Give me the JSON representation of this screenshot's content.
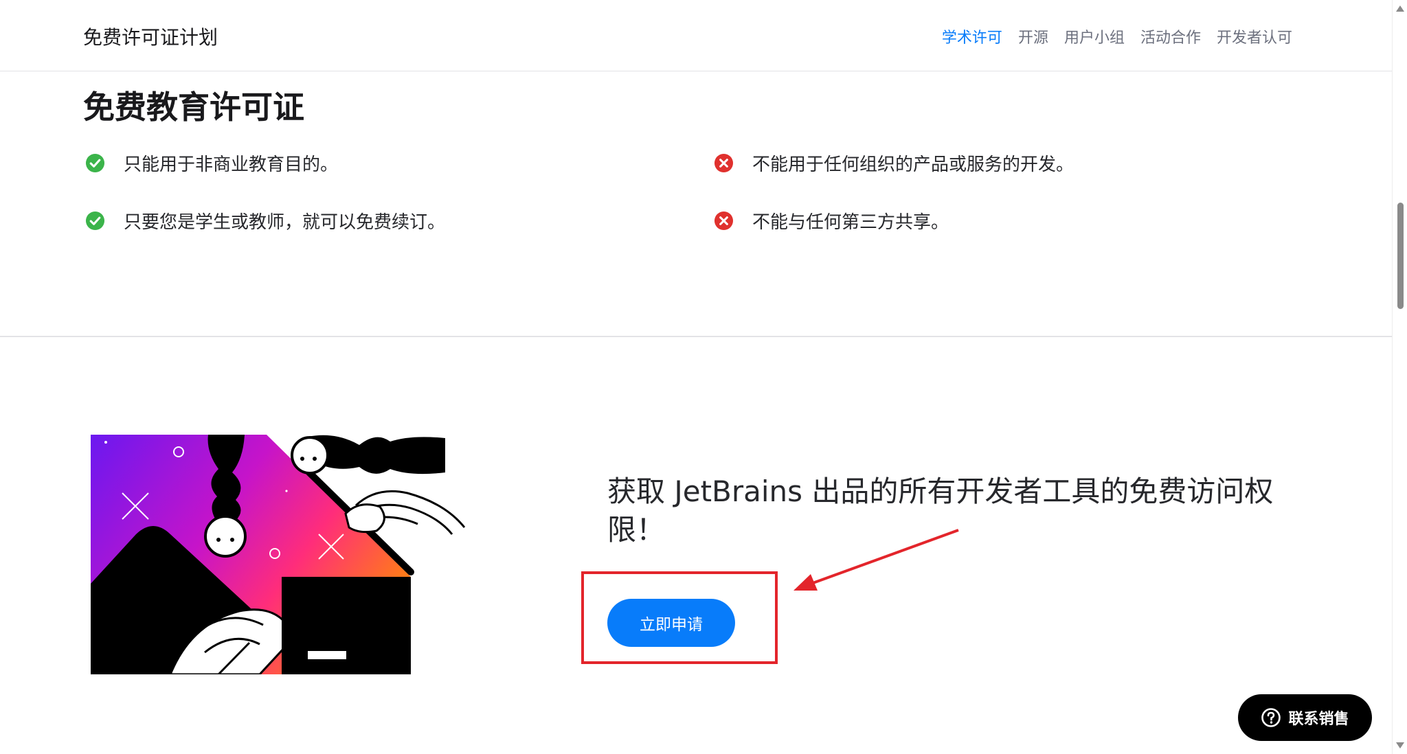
{
  "header": {
    "title": "免费许可证计划",
    "nav": [
      {
        "label": "学术许可",
        "active": true
      },
      {
        "label": "开源",
        "active": false
      },
      {
        "label": "用户小组",
        "active": false
      },
      {
        "label": "活动合作",
        "active": false
      },
      {
        "label": "开发者认可",
        "active": false
      }
    ]
  },
  "section": {
    "heading": "免费教育许可证",
    "allowed": [
      "只能用于非商业教育目的。",
      "只要您是学生或教师，就可以免费续订。"
    ],
    "denied": [
      "不能用于任何组织的产品或服务的开发。",
      "不能与任何第三方共享。"
    ]
  },
  "cta": {
    "text": "获取 JetBrains 出品的所有开发者工具的免费访问权限！",
    "button_label": "立即申请"
  },
  "contact": {
    "label": "联系销售",
    "icon": "question-circle-icon"
  },
  "icons": {
    "allowed": "check-circle-icon",
    "denied": "x-circle-icon"
  },
  "colors": {
    "accent": "#087cfa",
    "allowed": "#3bb44a",
    "denied": "#e0312e",
    "annotation": "#e3252b"
  }
}
